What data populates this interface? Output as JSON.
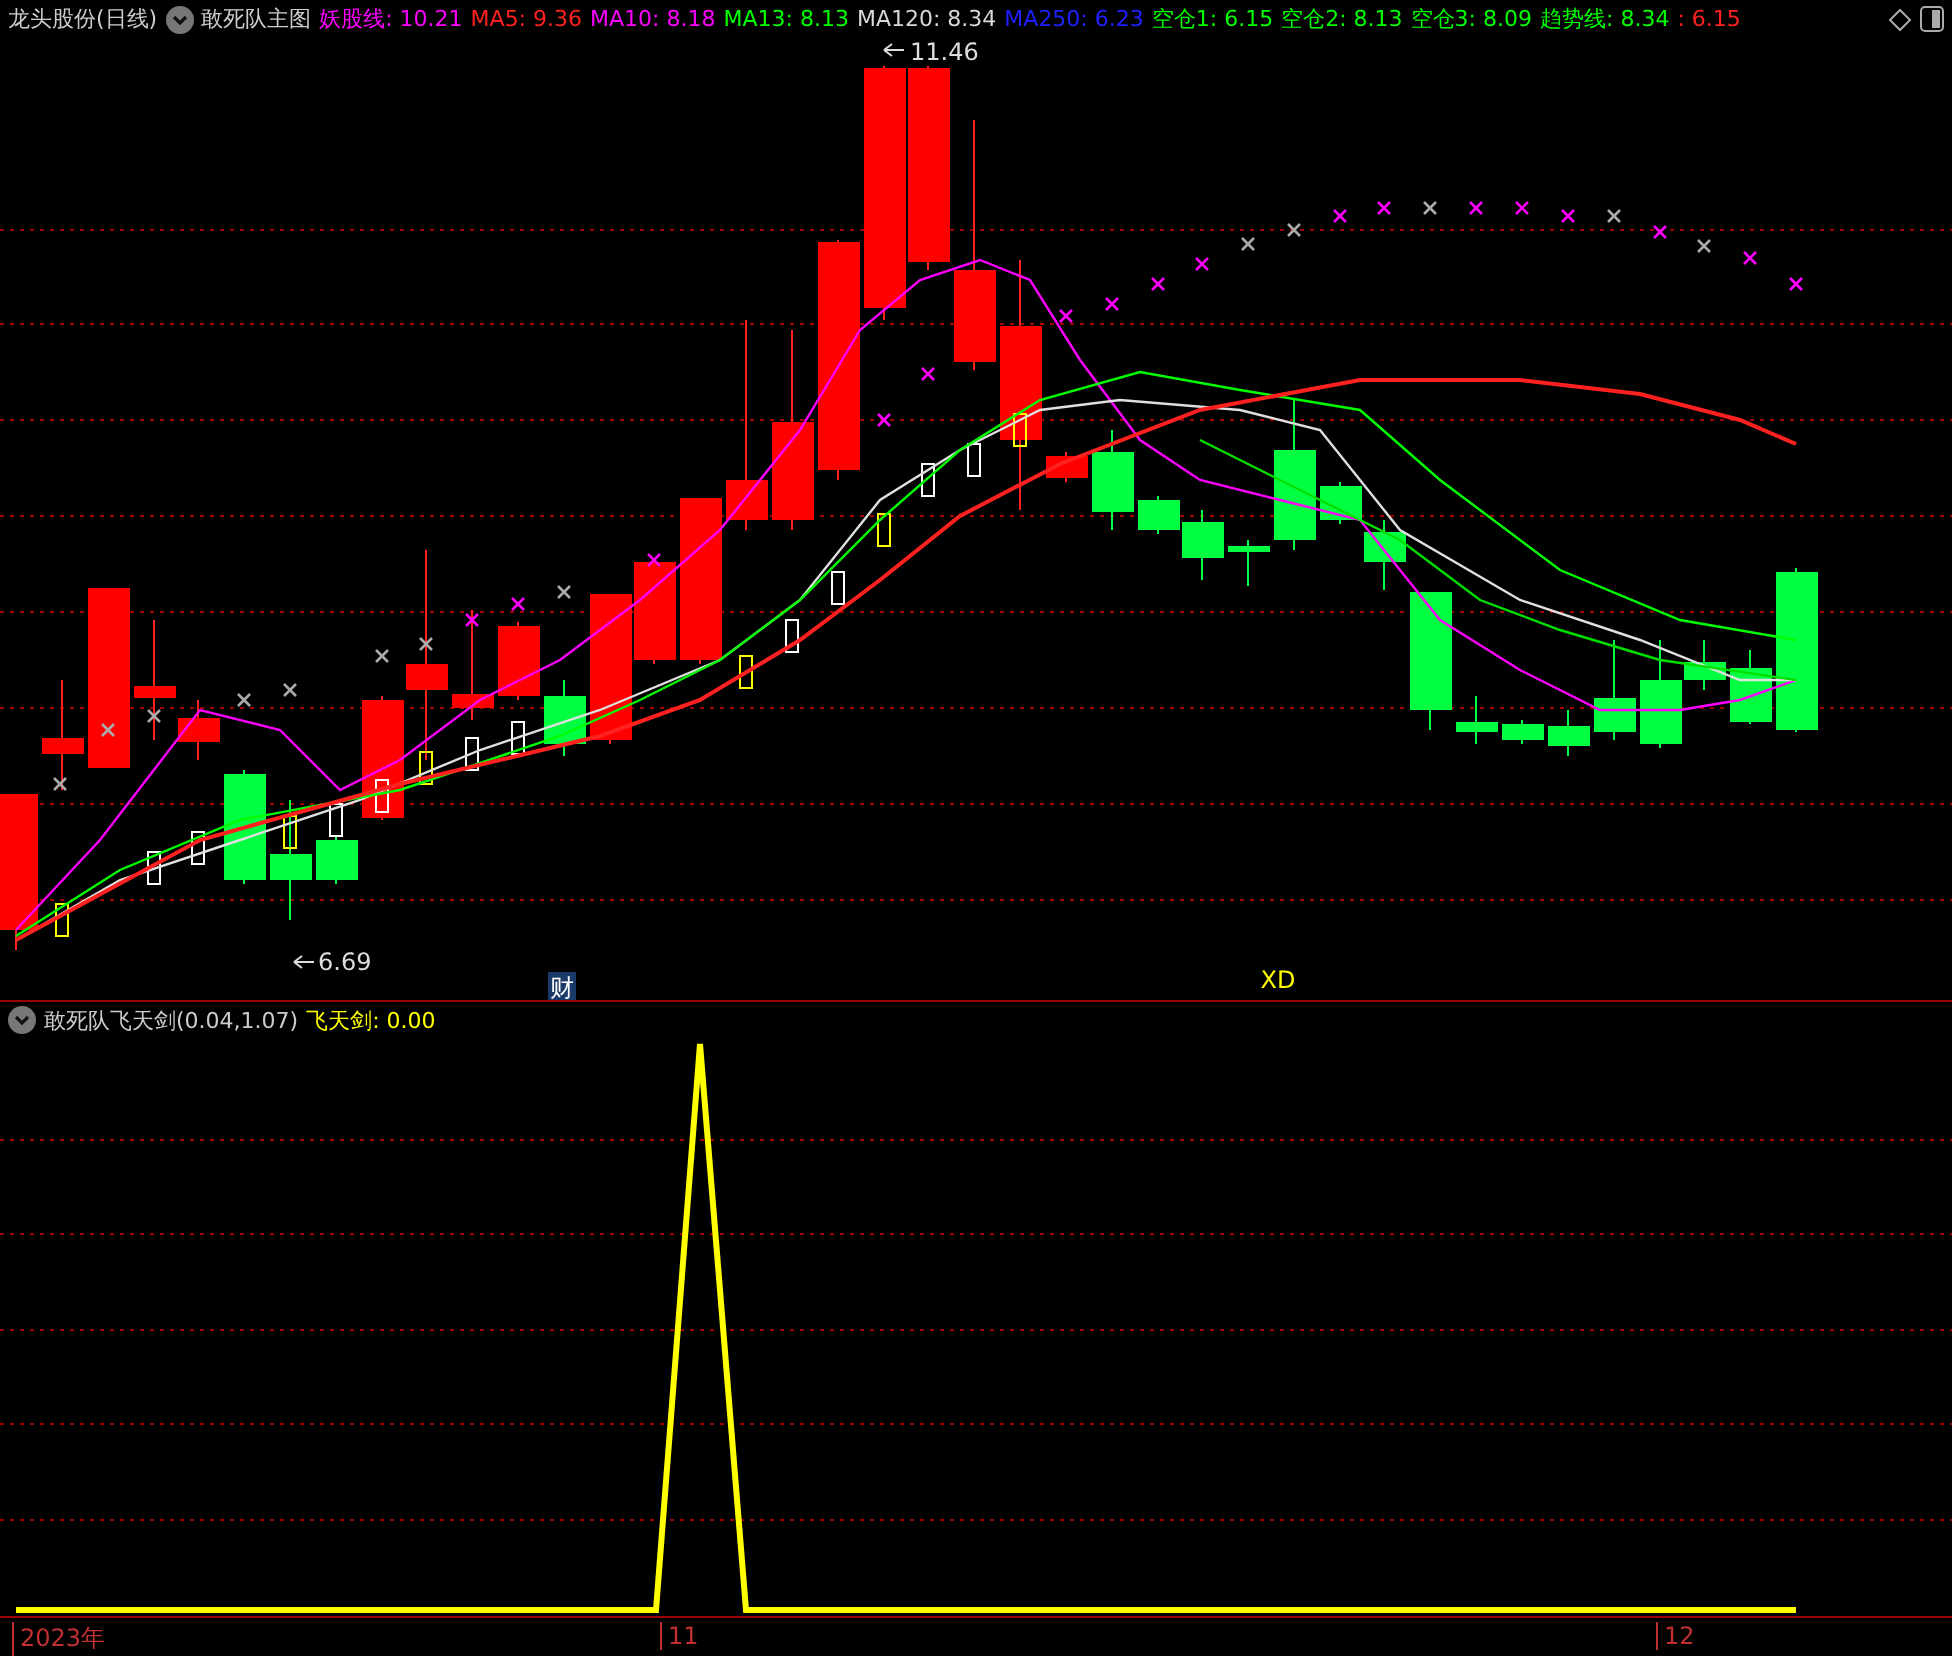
{
  "title": {
    "stock": "龙头股份(日线)",
    "indicator": "敢死队主图"
  },
  "legend": [
    {
      "text": "妖股线: 10.21",
      "color": "#ff00ff"
    },
    {
      "text": "MA5: 9.36",
      "color": "#ff2020"
    },
    {
      "text": "MA10: 8.18",
      "color": "#ff00ff"
    },
    {
      "text": "MA13: 8.13",
      "color": "#00ff00"
    },
    {
      "text": "MA120: 8.34",
      "color": "#d8d8d8"
    },
    {
      "text": "MA250: 6.23",
      "color": "#2020ff"
    },
    {
      "text": "空仓1: 6.15",
      "color": "#00ff00"
    },
    {
      "text": "空仓2: 8.13",
      "color": "#00ff00"
    },
    {
      "text": "空仓3: 8.09",
      "color": "#00ff00"
    },
    {
      "text": "趋势线: 8.34",
      "color": "#00ff00"
    },
    {
      "text": ": 6.15",
      "color": "#ff2020"
    }
  ],
  "price_chart": {
    "high_label": "11.46",
    "low_label": "6.69",
    "events": [
      {
        "text": "财",
        "kind": "finance"
      },
      {
        "text": "XD",
        "kind": "dividend"
      }
    ]
  },
  "indicator_panel": {
    "name": "敢死队飞天剑(0.04,1.07)",
    "legend": {
      "text": "飞天剑: 0.00",
      "color": "#ffff00"
    }
  },
  "time_axis": [
    "2023年",
    "11",
    "12"
  ]
}
